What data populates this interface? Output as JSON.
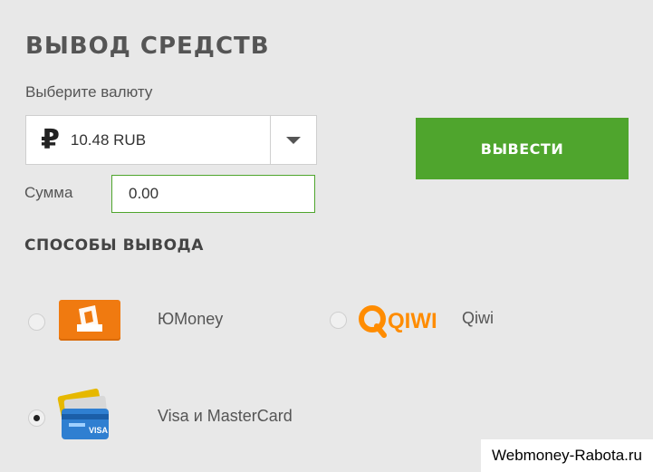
{
  "page": {
    "title": "ВЫВОД СРЕДСТВ",
    "currency_label": "Выберите валюту",
    "amount_label": "Сумма",
    "methods_title": "СПОСОБЫ ВЫВОДА",
    "watermark": "Webmoney-Rabota.ru"
  },
  "currency": {
    "symbol": "₽",
    "selected": "10.48 RUB"
  },
  "amount": {
    "value": "0.00"
  },
  "submit": {
    "label": "ВЫВЕСТИ"
  },
  "methods": [
    {
      "label": "ЮMoney",
      "selected": false,
      "icon": "yumoney-icon"
    },
    {
      "label": "Qiwi",
      "selected": false,
      "icon": "qiwi-icon",
      "logo_text": "QIWI"
    },
    {
      "label": "Visa и MasterCard",
      "selected": true,
      "icon": "credit-cards-icon",
      "logo_text": "VISA"
    }
  ],
  "colors": {
    "background": "#e8e8e8",
    "accent_green": "#4fa52d",
    "yumoney_orange": "#f07a10",
    "qiwi_orange": "#ff8c00"
  }
}
